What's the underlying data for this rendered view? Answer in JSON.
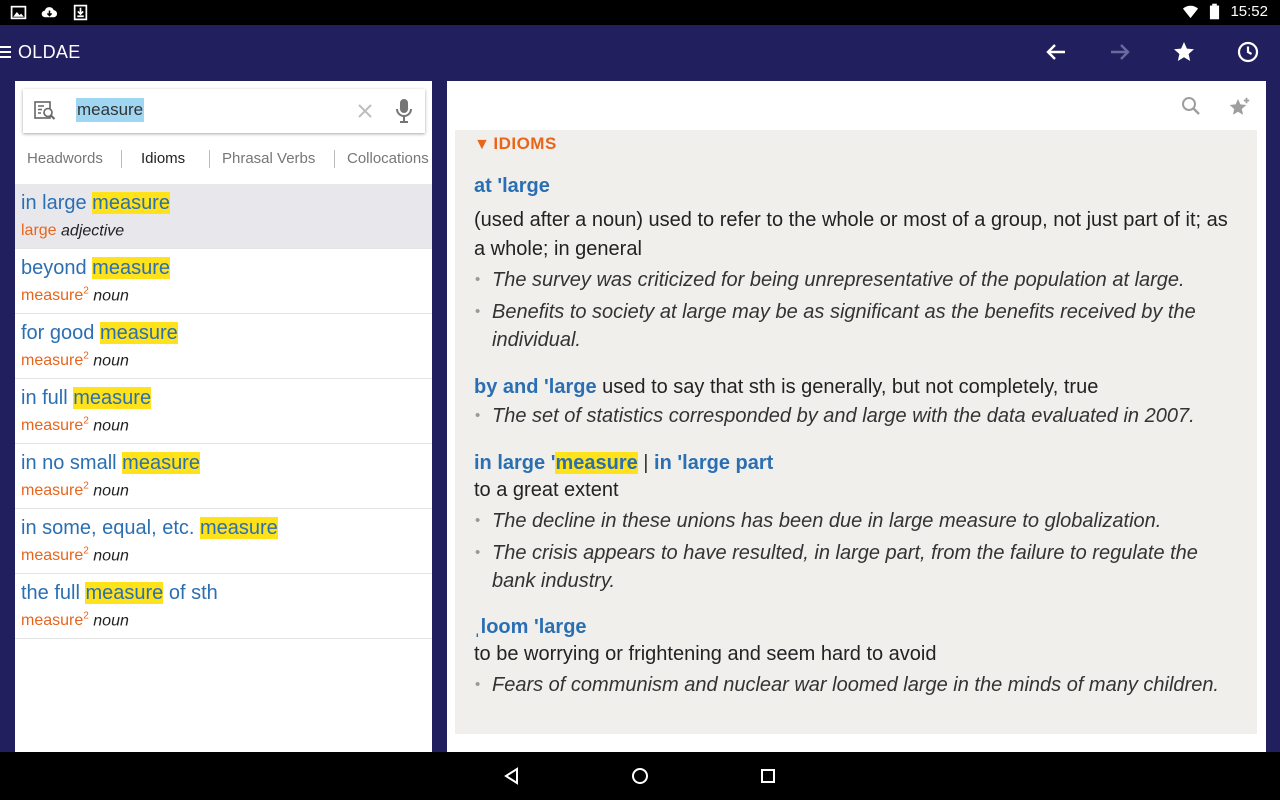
{
  "status_bar": {
    "time": "15:52"
  },
  "app_bar": {
    "title": "OLDAE"
  },
  "search": {
    "query": "measure"
  },
  "tabs": [
    "Headwords",
    "Idioms",
    "Phrasal Verbs",
    "Collocations"
  ],
  "results": [
    {
      "pre": "in large ",
      "hl": "measure",
      "post": "",
      "head": "large",
      "sup": "",
      "pos": "adjective"
    },
    {
      "pre": "beyond ",
      "hl": "measure",
      "post": "",
      "head": "measure",
      "sup": "2",
      "pos": "noun"
    },
    {
      "pre": "for good ",
      "hl": "measure",
      "post": "",
      "head": "measure",
      "sup": "2",
      "pos": "noun"
    },
    {
      "pre": "in full ",
      "hl": "measure",
      "post": "",
      "head": "measure",
      "sup": "2",
      "pos": "noun"
    },
    {
      "pre": "in no small ",
      "hl": "measure",
      "post": "",
      "head": "measure",
      "sup": "2",
      "pos": "noun"
    },
    {
      "pre": "in some, equal, etc. ",
      "hl": "measure",
      "post": "",
      "head": "measure",
      "sup": "2",
      "pos": "noun"
    },
    {
      "pre": "the full ",
      "hl": "measure",
      "post": " of sth",
      "head": "measure",
      "sup": "2",
      "pos": "noun"
    }
  ],
  "entry": {
    "section_label": "IDIOMS",
    "idioms": [
      {
        "title": "at 'large",
        "definition": "(used after a noun) used to refer to the whole or most of a group, not just part of it; as a whole; in general",
        "examples": [
          "The survey was criticized for being unrepresentative of the population at large.",
          "Benefits to society at large may be as significant as the benefits received by the individual."
        ]
      },
      {
        "title": "by and 'large",
        "definition": "used to say that sth is generally, but not completely, true",
        "examples": [
          "The set of statistics corresponded by and large with the data evaluated in 2007."
        ]
      },
      {
        "title_pre": "in large '",
        "title_hl": "measure",
        "title_sep": " | ",
        "title_alt": "in 'large part",
        "definition": "to a great extent",
        "examples": [
          "The decline in these unions has been due in large measure to globalization.",
          "The crisis appears to have resulted, in large part, from the failure to regulate the bank industry."
        ]
      },
      {
        "title": "ˌloom 'large",
        "definition": "to be worrying or frightening and seem hard to avoid",
        "examples": [
          "Fears of communism and nuclear war loomed large in the minds of many children."
        ]
      }
    ]
  },
  "colors": {
    "app_bar": "#221f5e",
    "link_blue": "#2b6fb3",
    "accent_orange": "#e8651b",
    "highlight": "#ffe21a"
  }
}
